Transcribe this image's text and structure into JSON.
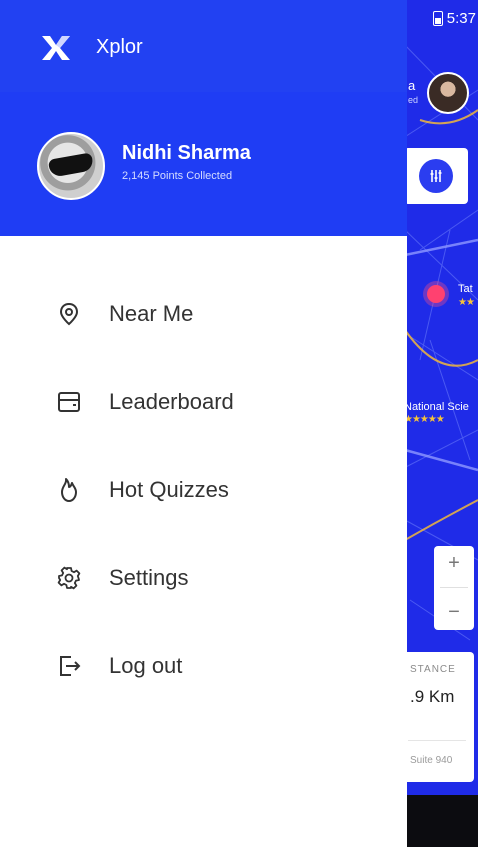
{
  "app": {
    "title": "Xplor",
    "logo_icon": "xplor-x-logo",
    "brand_color": "#2241f2"
  },
  "status_bar": {
    "time": "5:37",
    "battery_icon": "battery-charging-icon"
  },
  "profile": {
    "name": "Nidhi Sharma",
    "points": "2,145 Points Collected"
  },
  "menu": [
    {
      "label": "Near Me",
      "icon": "location-pin-icon"
    },
    {
      "label": "Leaderboard",
      "icon": "leaderboard-card-icon"
    },
    {
      "label": "Hot Quizzes",
      "icon": "flame-icon"
    },
    {
      "label": "Settings",
      "icon": "gear-icon"
    },
    {
      "label": "Log out",
      "icon": "logout-icon"
    }
  ],
  "map": {
    "user_name_partial": "a",
    "user_sub_partial": "ed",
    "pin_label": "Tat",
    "pin_stars": "★★",
    "place_label": "National Scie",
    "place_stars": "★★★★★",
    "zoom_in_label": "+",
    "zoom_out_label": "−",
    "distance_label": "STANCE",
    "distance_value": ".9 Km",
    "address": "Suite 940"
  }
}
